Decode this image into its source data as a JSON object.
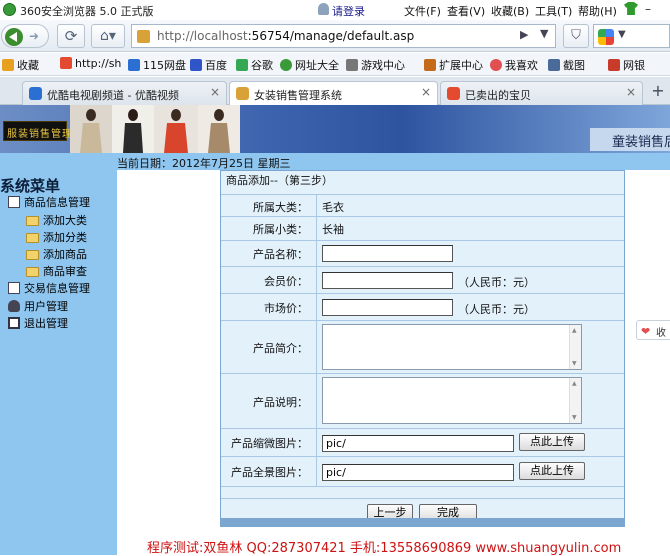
{
  "browser": {
    "title": "360安全浏览器 5.0 正式版",
    "login": "请登录",
    "menus": [
      "文件(F)",
      "查看(V)",
      "收藏(B)",
      "工具(T)",
      "帮助(H)"
    ],
    "window_buttons": [
      "–",
      "□",
      "×"
    ],
    "url_host": "http://localhost",
    "url_rest": ":56754/manage/default.asp",
    "go_icon": "▶",
    "dropdown_icon": "▼"
  },
  "favorites": [
    {
      "label": "收藏",
      "icon_color": "#e8a020"
    },
    {
      "label": "http://sh",
      "icon_color": "#e34a2f"
    },
    {
      "label": "115网盘",
      "icon_color": "#2a6fd1"
    },
    {
      "label": "百度",
      "icon_color": "#2f55c8"
    },
    {
      "label": "谷歌",
      "icon_color": "#34a853"
    },
    {
      "label": "网址大全",
      "icon_color": "#3a9a3a"
    },
    {
      "label": "游戏中心",
      "icon_color": "#777777"
    },
    {
      "label": "扩展中心",
      "icon_color": "#c46a1a"
    },
    {
      "label": "我喜欢",
      "icon_color": "#e05050"
    },
    {
      "label": "截图",
      "icon_color": "#4a6a9a"
    },
    {
      "label": "网银",
      "icon_color": "#c83a2a"
    }
  ],
  "tabs": [
    {
      "label": "优酷电视剧频道 - 优酷视频",
      "icon_color": "#2a6fd1"
    },
    {
      "label": "女装销售管理系统",
      "icon_color": "#d8a238"
    },
    {
      "label": "已卖出的宝贝",
      "icon_color": "#e34a2f"
    }
  ],
  "new_tab": "+",
  "page": {
    "logo": "服装销售管理",
    "site_title": "童装销售后",
    "date": "当前日期：2012年7月25日  星期三",
    "menu_title": "系统菜单",
    "menu": [
      {
        "label": "商品信息管理",
        "level": 0,
        "icon": "book-icon"
      },
      {
        "label": "添加大类",
        "level": 1,
        "icon": "folder-icon"
      },
      {
        "label": "添加分类",
        "level": 1,
        "icon": "folder-icon"
      },
      {
        "label": "添加商品",
        "level": 1,
        "icon": "folder-icon"
      },
      {
        "label": "商品审查",
        "level": 1,
        "icon": "folder-icon"
      },
      {
        "label": "交易信息管理",
        "level": 0,
        "icon": "book-icon"
      },
      {
        "label": "用户管理",
        "level": 0,
        "icon": "person-icon"
      },
      {
        "label": "退出管理",
        "level": 0,
        "icon": "exit-icon"
      }
    ],
    "form": {
      "title": "商品添加--（第三步）",
      "category_label": "所属大类：",
      "category_value": "毛衣",
      "subcategory_label": "所属小类：",
      "subcategory_value": "长袖",
      "name_label": "产品名称：",
      "name_value": "",
      "member_price_label": "会员价：",
      "member_price_value": "",
      "market_price_label": "市场价：",
      "market_price_value": "",
      "unit_label": "（人民币：元）",
      "intro_label": "产品简介：",
      "desc_label": "产品说明：",
      "thumb_label": "产品缩微图片：",
      "thumb_value": "pic/",
      "full_label": "产品全景图片：",
      "full_value": "pic/",
      "upload_button": "点此上传",
      "prev_button": "上一步",
      "finish_button": "完成"
    },
    "footer": "程序测试:双鱼林 QQ:287307421 手机:13558690869 www.shuangyulin.com",
    "side_widget": "收"
  }
}
